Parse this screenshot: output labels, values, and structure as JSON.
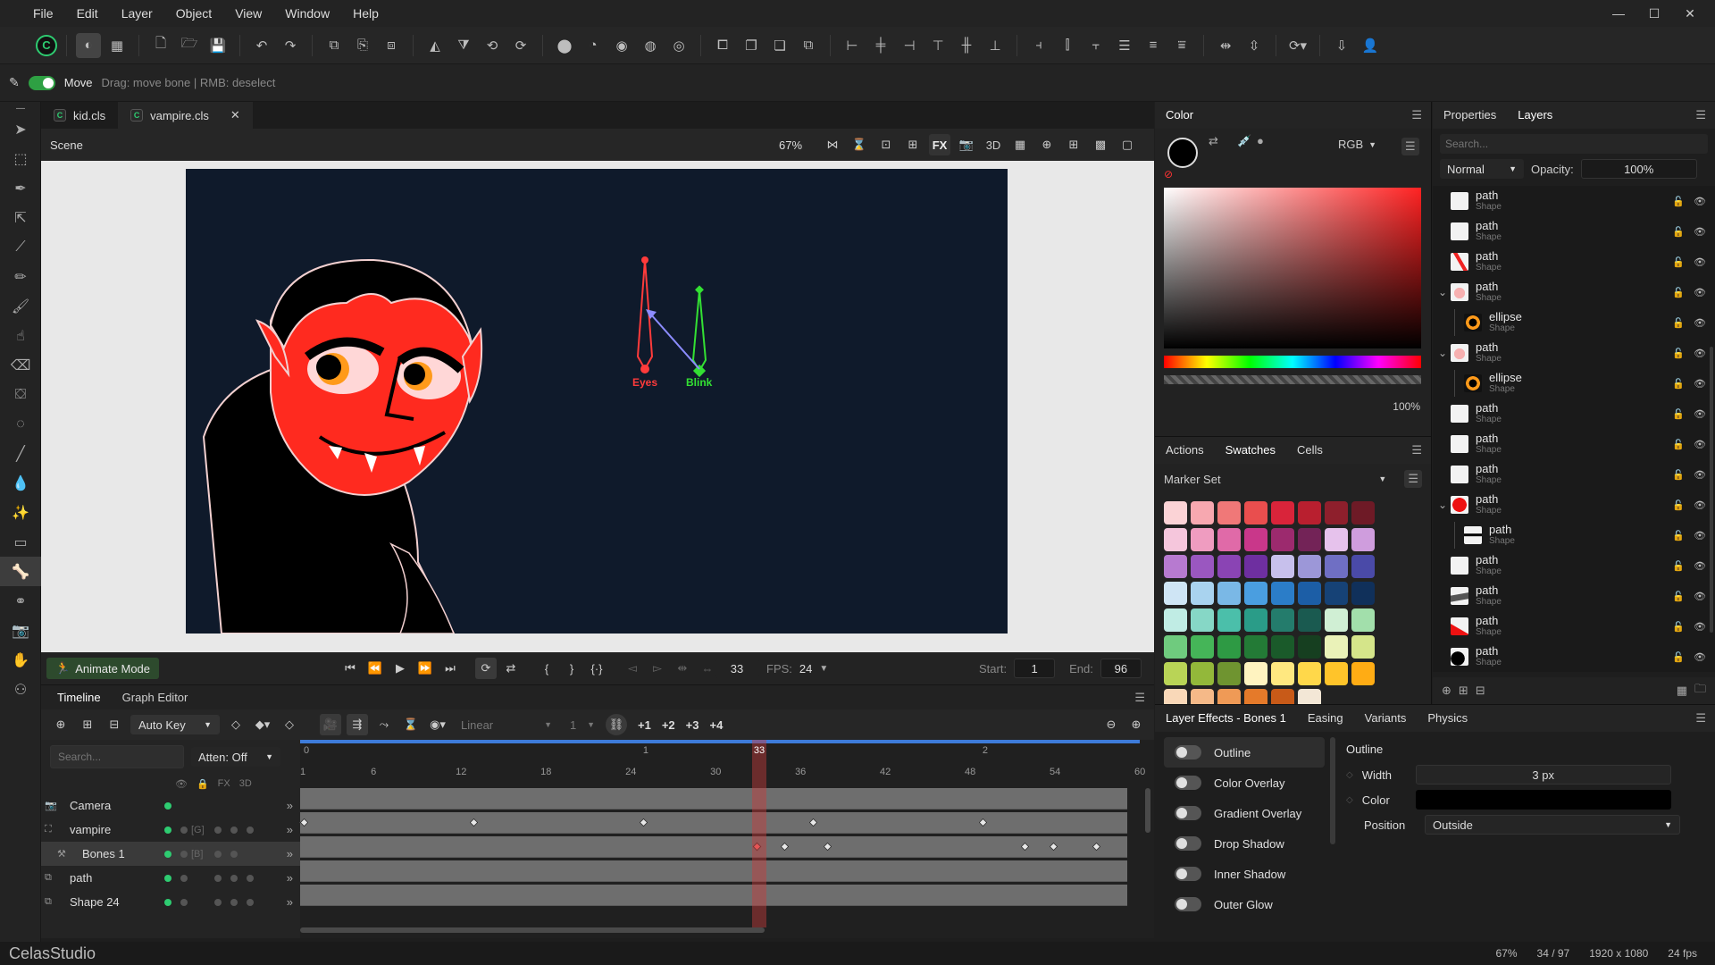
{
  "menu": [
    "File",
    "Edit",
    "Layer",
    "Object",
    "View",
    "Window",
    "Help"
  ],
  "window": {
    "minimize": "—",
    "maximize": "☐",
    "close": "✕"
  },
  "options": {
    "tool": "Move",
    "hint": "Drag: move bone | RMB: deselect"
  },
  "tabs": [
    {
      "name": "kid.cls"
    },
    {
      "name": "vampire.cls"
    }
  ],
  "scene": {
    "label": "Scene",
    "zoom": "67%",
    "fx": "FX",
    "3d": "3D"
  },
  "bones": {
    "eyes": "Eyes",
    "blink": "Blink",
    "eyes_color": "#ff3b3b",
    "blink_color": "#33e033"
  },
  "transport": {
    "animate_mode": "Animate Mode",
    "frame": "33",
    "fps_label": "FPS:",
    "fps": "24",
    "start_label": "Start:",
    "start": "1",
    "end_label": "End:",
    "end": "96"
  },
  "timeline": {
    "tabs": [
      "Timeline",
      "Graph Editor"
    ],
    "auto_key": "Auto Key",
    "interp": "Linear",
    "step": "1",
    "plus": [
      "+1",
      "+2",
      "+3",
      "+4"
    ],
    "search_placeholder": "Search...",
    "atten": "Atten: Off",
    "fx": "FX",
    "threed": "3D",
    "seconds": [
      "0",
      "1",
      "2"
    ],
    "ticks": [
      "1",
      "6",
      "12",
      "18",
      "24",
      "30",
      "36",
      "42",
      "48",
      "54",
      "60"
    ],
    "current": "33",
    "layers": [
      {
        "name": "Camera",
        "tag": ""
      },
      {
        "name": "vampire",
        "tag": "[G]"
      },
      {
        "name": "Bones 1",
        "tag": "[B]"
      },
      {
        "name": "path",
        "tag": ""
      },
      {
        "name": "Shape 24",
        "tag": ""
      }
    ]
  },
  "color": {
    "title": "Color",
    "mode": "RGB",
    "alpha": "100%"
  },
  "swatches": {
    "tabs": [
      "Actions",
      "Swatches",
      "Cells"
    ],
    "set": "Marker Set",
    "colors": [
      "#fbd3d6",
      "#f7a8b0",
      "#f07878",
      "#e94e4e",
      "#d9243a",
      "#b91f2f",
      "#8e1f2c",
      "#6e1a26",
      "#f5c6dc",
      "#ef9cc0",
      "#e06aa8",
      "#c9378a",
      "#9c2a6e",
      "#732357",
      "#e6c2ec",
      "#cf9ddd",
      "#b77ad0",
      "#9a57c0",
      "#8a44b4",
      "#6e2fa0",
      "#c7c0ec",
      "#9c97d8",
      "#6f6fc4",
      "#4a4aa8",
      "#cfe5f5",
      "#a9d3ef",
      "#7ab8e6",
      "#4a9ee0",
      "#2b7dc8",
      "#1c5ea6",
      "#164276",
      "#10305a",
      "#c0ece4",
      "#86d7c6",
      "#4bbfaa",
      "#2a9c88",
      "#247c6c",
      "#1a5a50",
      "#d0efd4",
      "#a2dfab",
      "#6fcb7e",
      "#45b558",
      "#2e9a44",
      "#237a36",
      "#1a5a2a",
      "#163f20",
      "#eaf2b8",
      "#d5e58a",
      "#b9d456",
      "#93b83a",
      "#6f9430",
      "#fff3c0",
      "#ffe880",
      "#ffd84a",
      "#ffc42a",
      "#ffac14",
      "#f9d8b8",
      "#f5b988",
      "#ef9a56",
      "#e57a2a",
      "#c85a18",
      "#f3e7d6"
    ]
  },
  "props": {
    "tabs": [
      "Properties",
      "Layers"
    ],
    "search_placeholder": "Search...",
    "blend": "Normal",
    "opacity_label": "Opacity:",
    "opacity": "100%",
    "layers": [
      {
        "name": "path",
        "sub": "Shape",
        "indent": 0,
        "thumb": "white",
        "caret": ""
      },
      {
        "name": "path",
        "sub": "Shape",
        "indent": 0,
        "thumb": "white",
        "caret": ""
      },
      {
        "name": "path",
        "sub": "Shape",
        "indent": 0,
        "thumb": "redtri",
        "caret": ""
      },
      {
        "name": "path",
        "sub": "Shape",
        "indent": 0,
        "thumb": "pink",
        "caret": "⌄"
      },
      {
        "name": "ellipse",
        "sub": "Shape",
        "indent": 1,
        "thumb": "eye",
        "caret": ""
      },
      {
        "name": "path",
        "sub": "Shape",
        "indent": 0,
        "thumb": "pink",
        "caret": "⌄"
      },
      {
        "name": "ellipse",
        "sub": "Shape",
        "indent": 1,
        "thumb": "eye",
        "caret": ""
      },
      {
        "name": "path",
        "sub": "Shape",
        "indent": 0,
        "thumb": "white",
        "caret": ""
      },
      {
        "name": "path",
        "sub": "Shape",
        "indent": 0,
        "thumb": "white",
        "caret": ""
      },
      {
        "name": "path",
        "sub": "Shape",
        "indent": 0,
        "thumb": "white",
        "caret": ""
      },
      {
        "name": "path",
        "sub": "Shape",
        "indent": 0,
        "thumb": "reddot",
        "caret": "⌄"
      },
      {
        "name": "path",
        "sub": "Shape",
        "indent": 1,
        "thumb": "mouth",
        "caret": ""
      },
      {
        "name": "path",
        "sub": "Shape",
        "indent": 0,
        "thumb": "white",
        "caret": ""
      },
      {
        "name": "path",
        "sub": "Shape",
        "indent": 0,
        "thumb": "grey",
        "caret": ""
      },
      {
        "name": "path",
        "sub": "Shape",
        "indent": 0,
        "thumb": "redcape",
        "caret": ""
      },
      {
        "name": "path",
        "sub": "Shape",
        "indent": 0,
        "thumb": "black",
        "caret": ""
      }
    ]
  },
  "effects": {
    "tabs": [
      "Layer Effects - Bones 1",
      "Easing",
      "Variants",
      "Physics"
    ],
    "items": [
      "Outline",
      "Color Overlay",
      "Gradient Overlay",
      "Drop Shadow",
      "Inner Shadow",
      "Outer Glow"
    ],
    "detail": {
      "title": "Outline",
      "width_label": "Width",
      "width": "3 px",
      "color_label": "Color",
      "position_label": "Position",
      "position": "Outside"
    }
  },
  "status": {
    "app": "CelasStudio",
    "zoom": "67%",
    "frame": "34 / 97",
    "size": "1920 x 1080",
    "fps": "24 fps"
  }
}
